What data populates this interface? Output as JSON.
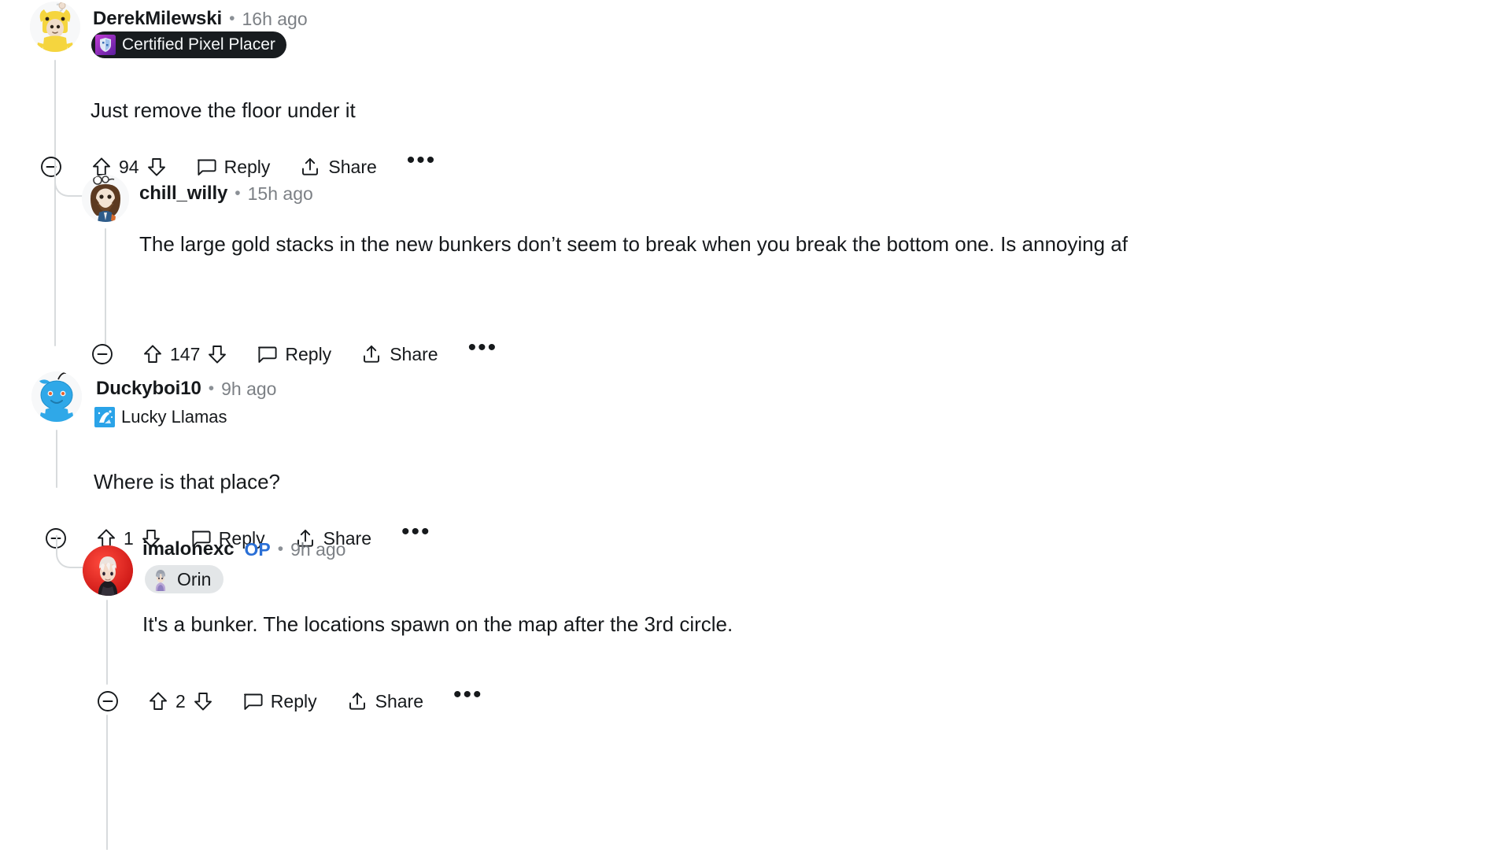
{
  "theme": {
    "background": "#ffffff",
    "text_primary": "#16191c",
    "text_muted": "#7c8085",
    "thread_line": "#d8dbdd",
    "op_blue": "#2a6fd6",
    "flair_dark_bg": "#181c1f",
    "flair_pill_bg": "#e3e6e8"
  },
  "actions": {
    "collapse_icon": "collapse-minus-circle-icon",
    "upvote_icon": "upvote-arrow-icon",
    "downvote_icon": "downvote-arrow-icon",
    "comment_icon": "comment-bubble-icon",
    "share_icon": "share-arrow-icon",
    "more_icon": "more-options-ellipsis-icon",
    "reply_label": "Reply",
    "share_label": "Share",
    "more_label": "•••"
  },
  "comments": [
    {
      "id": "c1",
      "depth": 0,
      "username": "DerekMilewski",
      "op": false,
      "separator": "•",
      "timestamp": "16h ago",
      "avatar_icon": "snoo-yellow-hood-avatar",
      "flair": {
        "style": "dark",
        "icon": "pixel-trophy-badge-icon",
        "label": "Certified Pixel Placer"
      },
      "text": "Just remove the floor under it",
      "vote_count": "94"
    },
    {
      "id": "c2",
      "depth": 1,
      "username": "chill_willy",
      "op": false,
      "separator": "•",
      "timestamp": "15h ago",
      "avatar_icon": "snoo-bearded-brown-hair-avatar",
      "flair": null,
      "text": "The large gold stacks in the new bunkers don’t seem to break when you break the bottom one. Is annoying af",
      "vote_count": "147"
    },
    {
      "id": "c3",
      "depth": 0,
      "username": "Duckyboi10",
      "op": false,
      "separator": "•",
      "timestamp": "9h ago",
      "avatar_icon": "snoo-blue-avatar",
      "flair": {
        "style": "plain",
        "icon": "lucky-llamas-blue-square-icon",
        "label": "Lucky Llamas"
      },
      "text": "Where is that place?",
      "vote_count": "1"
    },
    {
      "id": "c4",
      "depth": 1,
      "username": "imalonexc",
      "op": true,
      "op_label": "OP",
      "separator": "•",
      "timestamp": "9h ago",
      "avatar_icon": "anime-white-hair-red-circle-avatar",
      "flair": {
        "style": "pill",
        "icon": "orin-character-icon",
        "label": "Orin"
      },
      "text": "It's a bunker. The locations spawn on the map after the 3rd circle.",
      "vote_count": "2"
    }
  ]
}
